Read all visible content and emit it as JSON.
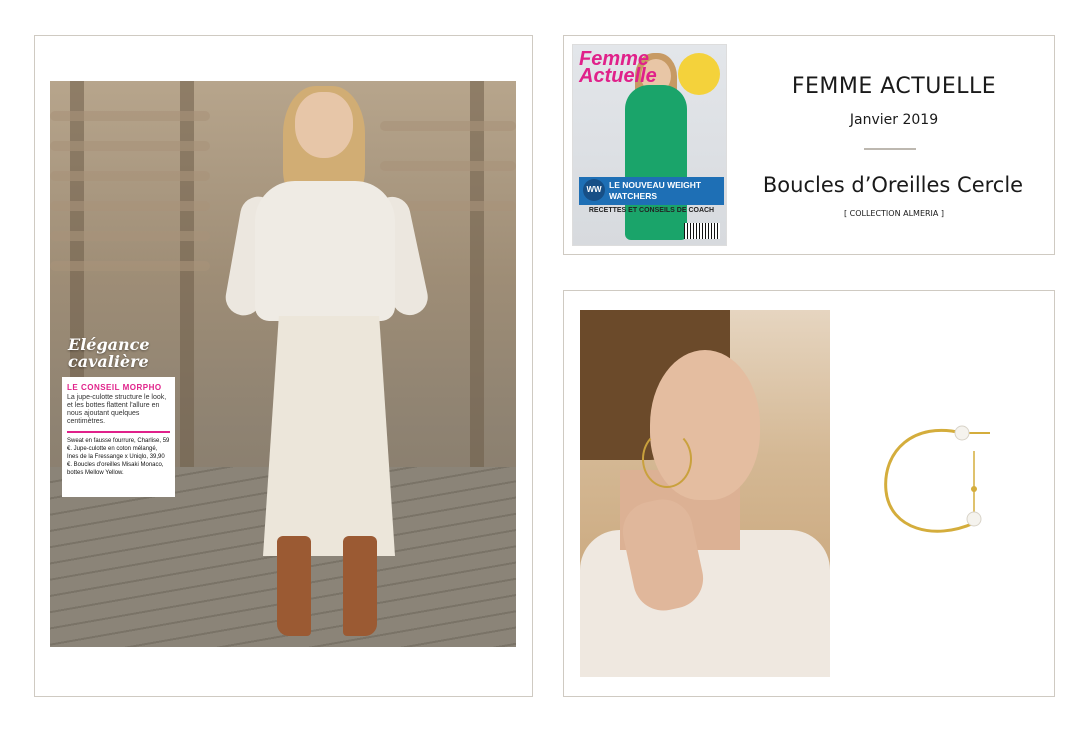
{
  "press": {
    "magazine": "FEMME ACTUELLE",
    "date": "Janvier 2019",
    "product": "Boucles d’Oreilles Cercle",
    "collection": "[ COLLECTION ALMERIA ]"
  },
  "cover": {
    "logo": "Femme Actuelle",
    "ww_badge": "WW",
    "band": "LE NOUVEAU WEIGHT WATCHERS",
    "subline": "RECETTES ET CONSEILS DE COACH"
  },
  "article": {
    "title_line1": "Elégance",
    "title_line2": "cavalière",
    "box_heading": "LE CONSEIL MORPHO",
    "box_text": "La jupe-culotte structure le look, et les bottes flattent l'allure en nous ajoutant quelques centimètres.",
    "credits": "Sweat en fausse fourrure, Charlise, 59 €. Jupe-culotte en coton mélangé, Ines de la Fressange x Uniqlo, 39,90 €. Boucles d'oreilles Misaki Monaco, bottes Mellow Yellow."
  },
  "colors": {
    "accent_pink": "#e0218a",
    "gold": "#c9a13d",
    "border": "#cfcac2"
  }
}
